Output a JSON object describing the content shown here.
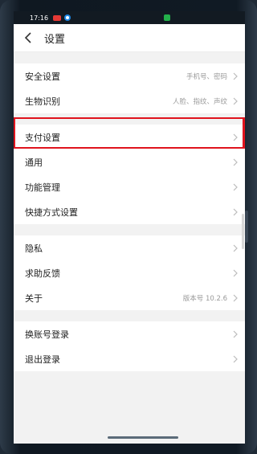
{
  "status_bar": {
    "time": "17:16",
    "icons": [
      "red-app-badge-icon",
      "blue-app-badge-icon",
      "green-app-badge-icon"
    ]
  },
  "header": {
    "title": "设置",
    "back_icon": "chevron-left-icon"
  },
  "groups": [
    {
      "items": [
        {
          "label": "安全设置",
          "value": "手机号、密码"
        },
        {
          "label": "生物识别",
          "value": "人脸、指纹、声纹"
        }
      ]
    },
    {
      "items": [
        {
          "label": "支付设置",
          "value": "",
          "highlighted": true
        },
        {
          "label": "通用",
          "value": ""
        },
        {
          "label": "功能管理",
          "value": ""
        },
        {
          "label": "快捷方式设置",
          "value": ""
        }
      ]
    },
    {
      "items": [
        {
          "label": "隐私",
          "value": ""
        },
        {
          "label": "求助反馈",
          "value": ""
        },
        {
          "label": "关于",
          "value": "版本号 10.2.6"
        }
      ]
    },
    {
      "items": [
        {
          "label": "换账号登录",
          "value": ""
        },
        {
          "label": "退出登录",
          "value": ""
        }
      ]
    }
  ],
  "colors": {
    "highlight": "#e0141e",
    "background": "#f2f2f2",
    "status_bar": "#121a22"
  }
}
